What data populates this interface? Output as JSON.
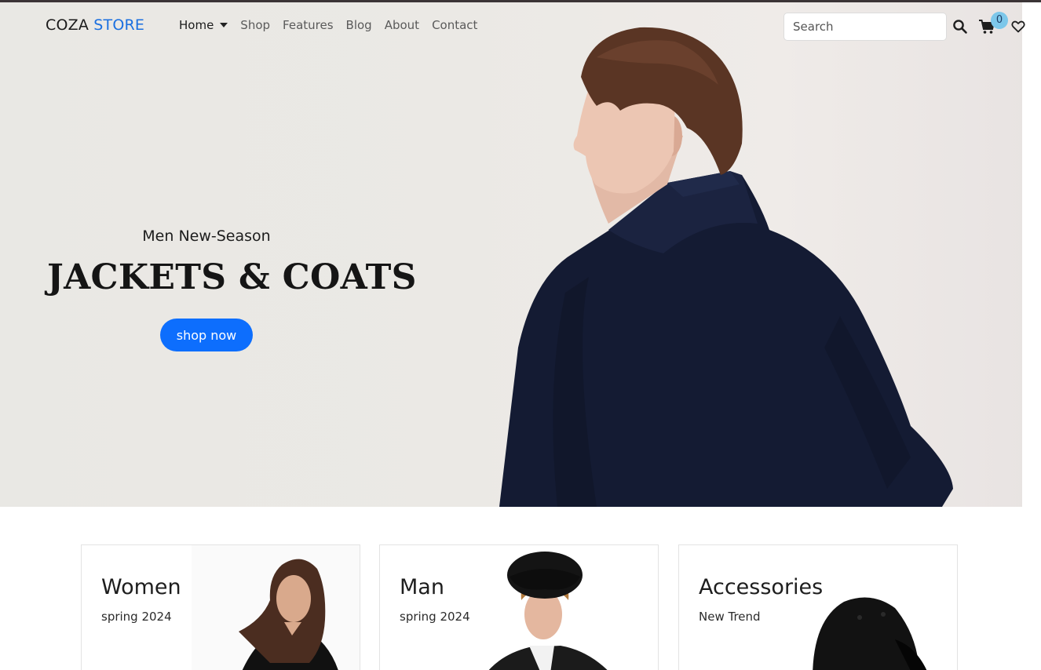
{
  "brand": {
    "name": "COZA",
    "accent": "STORE",
    "accent_color": "#1a6fe0"
  },
  "nav": {
    "items": [
      {
        "label": "Home",
        "active": true,
        "dropdown": true
      },
      {
        "label": "Shop"
      },
      {
        "label": "Features"
      },
      {
        "label": "Blog"
      },
      {
        "label": "About"
      },
      {
        "label": "Contact"
      }
    ]
  },
  "search": {
    "placeholder": "Search"
  },
  "icons": {
    "search": "search-icon",
    "cart": "cart-icon",
    "wishlist": "heart-icon"
  },
  "cart": {
    "count": "0"
  },
  "hero": {
    "subtitle": "Men New-Season",
    "title": "JACKETS & COATS",
    "button": "shop now",
    "button_color": "#0d6efd"
  },
  "categories": [
    {
      "title": "Women",
      "subtitle": "spring 2024"
    },
    {
      "title": "Man",
      "subtitle": "spring 2024"
    },
    {
      "title": "Accessories",
      "subtitle": "New Trend"
    }
  ]
}
